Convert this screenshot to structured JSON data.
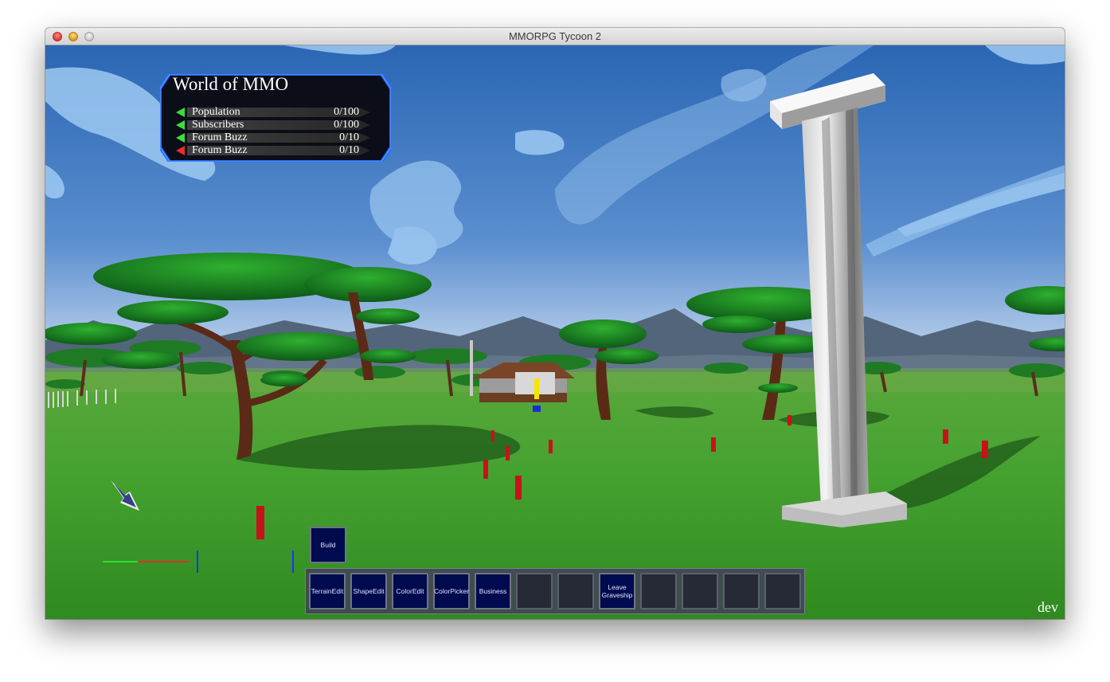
{
  "window": {
    "title": "MMORPG Tycoon 2"
  },
  "stats": {
    "world_name": "World of MMO",
    "rows": [
      {
        "label": "Population",
        "value": "0/100",
        "trend": "up"
      },
      {
        "label": "Subscribers",
        "value": "0/100",
        "trend": "up"
      },
      {
        "label": "Forum Buzz",
        "value": "0/10",
        "trend": "up"
      },
      {
        "label": "Forum Buzz",
        "value": "0/10",
        "trend": "down"
      }
    ]
  },
  "build_button": {
    "label": "Build"
  },
  "toolbar": {
    "slots": [
      {
        "label": "TerrainEdit"
      },
      {
        "label": "ShapeEdit"
      },
      {
        "label": "ColorEdit"
      },
      {
        "label": "ColorPicker"
      },
      {
        "label": "Business"
      },
      {
        "label": ""
      },
      {
        "label": ""
      },
      {
        "label": "Leave\nGraveship"
      },
      {
        "label": ""
      },
      {
        "label": ""
      },
      {
        "label": ""
      },
      {
        "label": ""
      }
    ]
  },
  "build_label": "dev",
  "icons": {
    "cursor": "arrow-cursor-icon",
    "trend_up": "green-left-arrow-icon",
    "trend_down": "red-left-arrow-icon"
  },
  "colors": {
    "trend_up": "#3adf3a",
    "trend_down": "#f02a2a",
    "panel_border": "#1f6bff",
    "slot_fill": "#000a4e"
  }
}
